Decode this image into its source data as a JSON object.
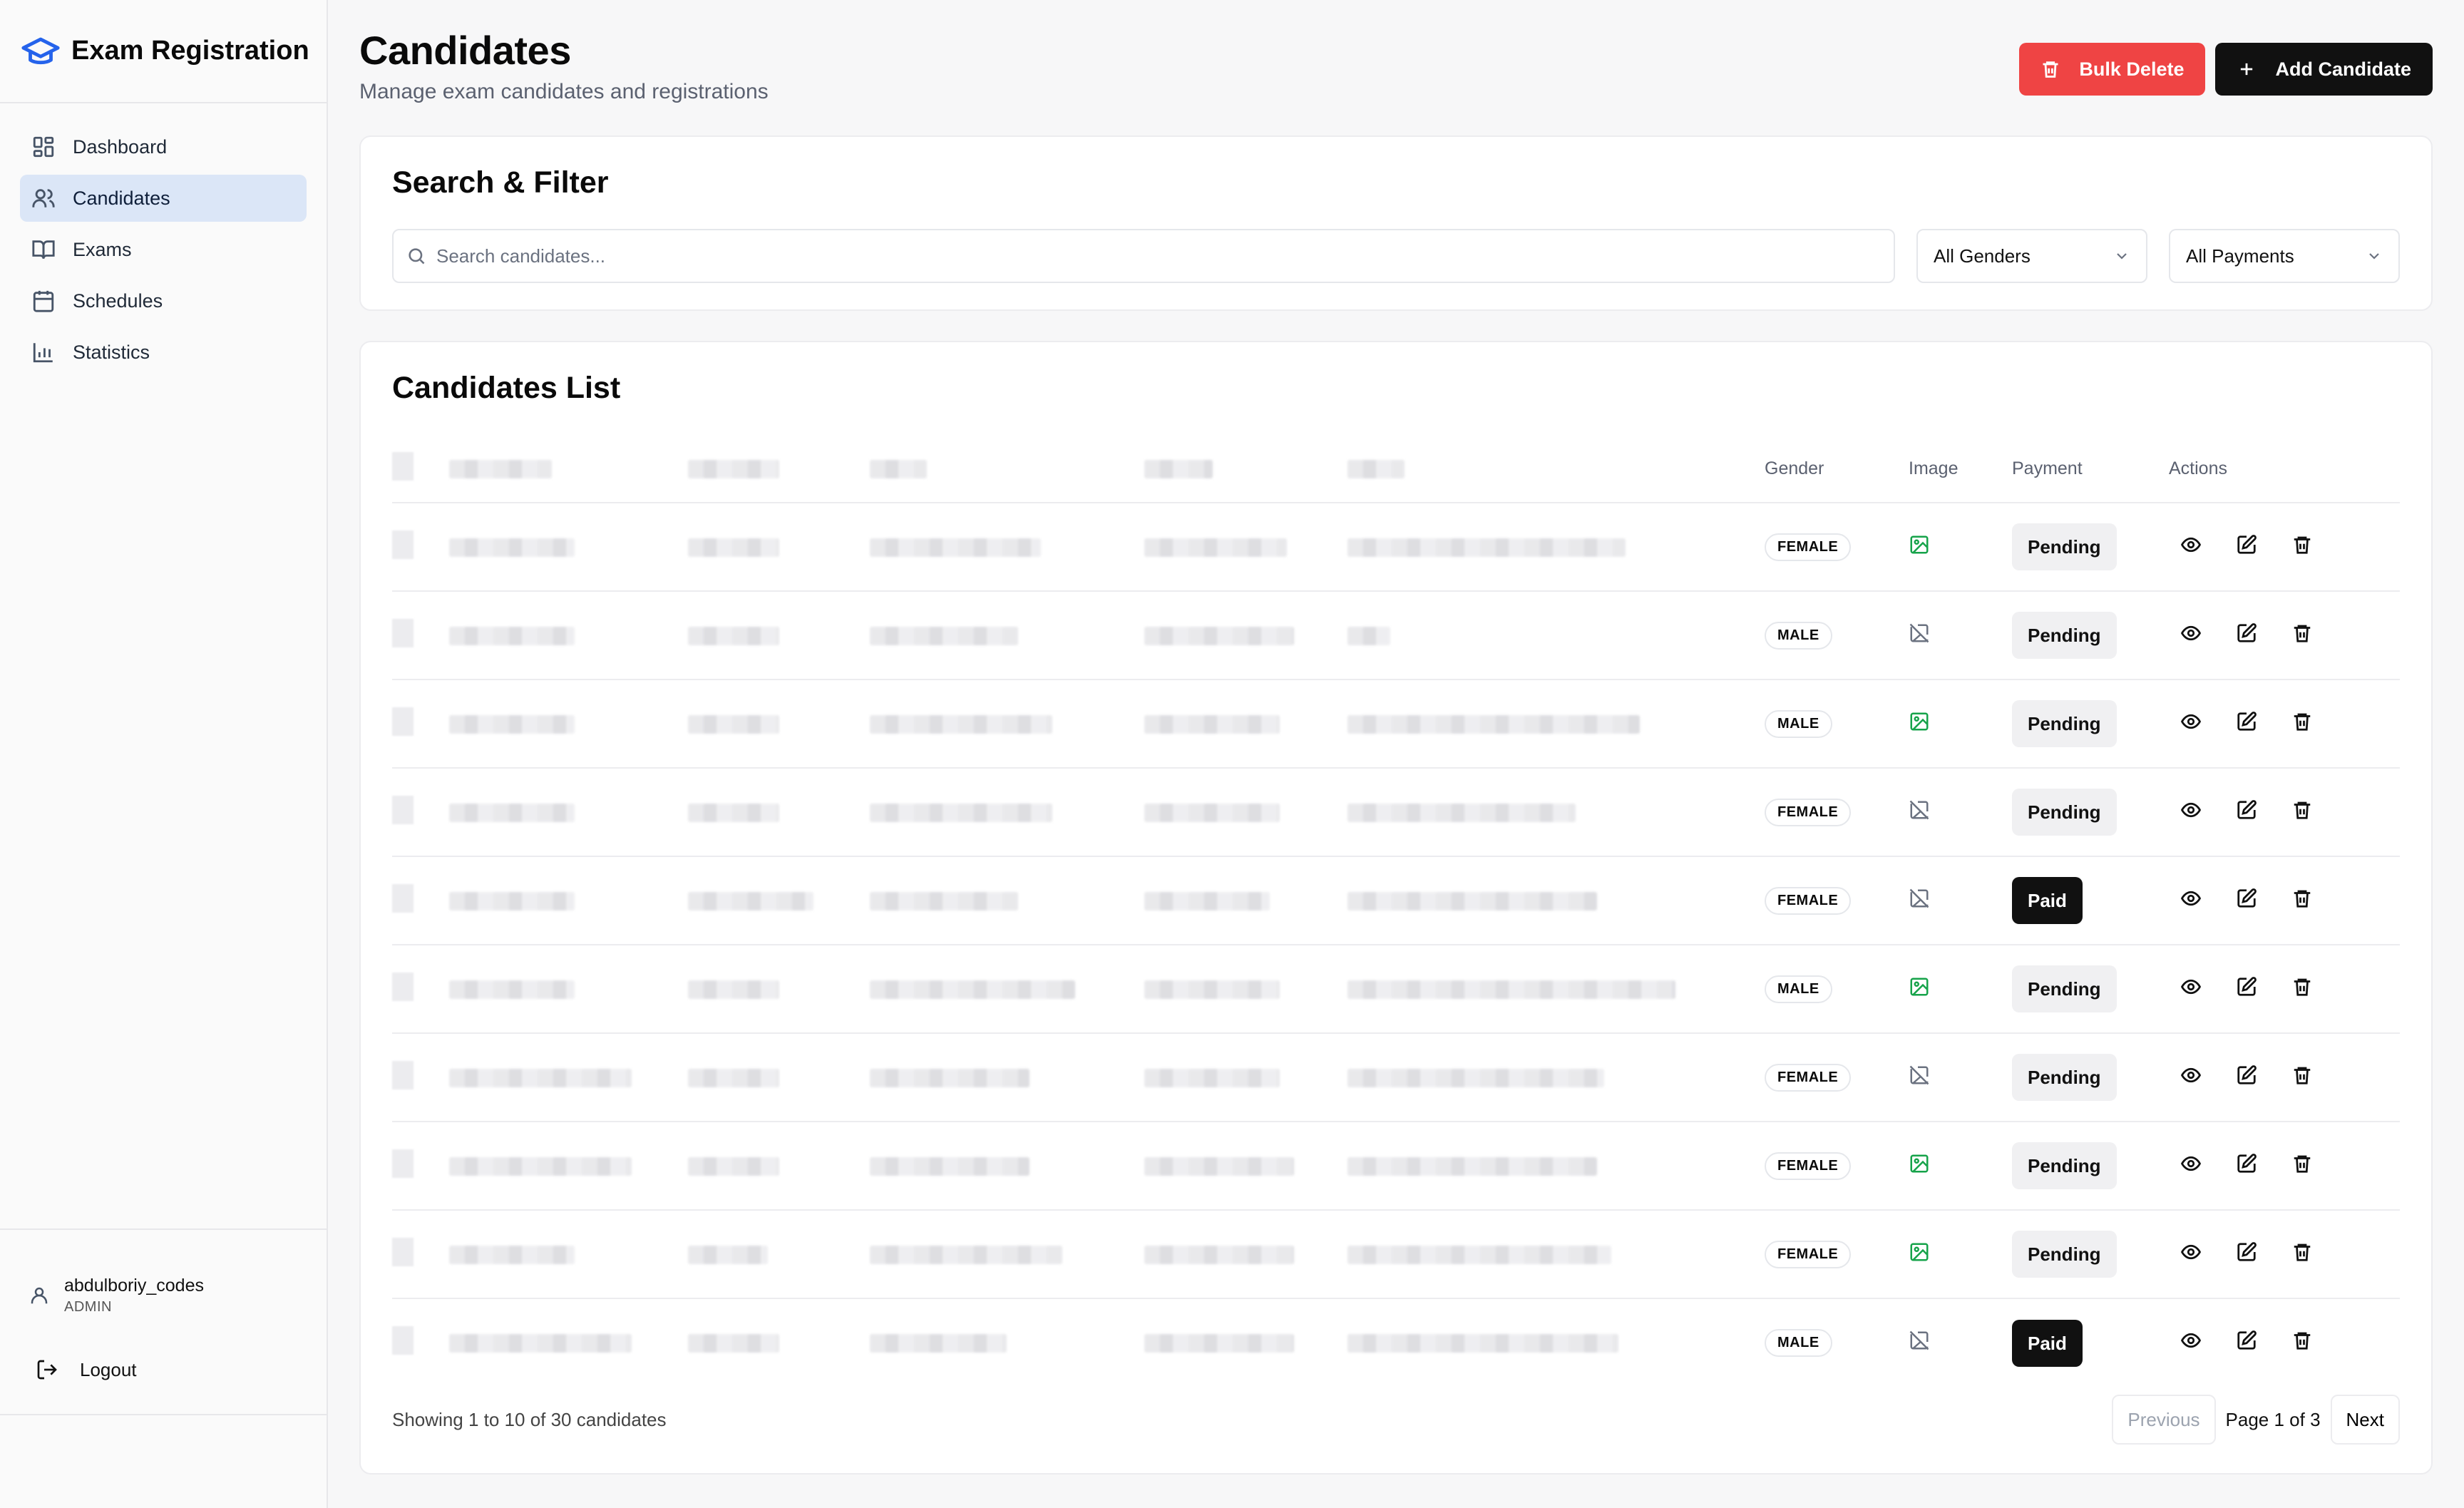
{
  "brand": {
    "name": "Exam Registration",
    "logo_icon": "graduation-cap-icon",
    "accent": "#2563eb"
  },
  "nav": [
    {
      "label": "Dashboard",
      "icon": "dashboard-icon",
      "active": false
    },
    {
      "label": "Candidates",
      "icon": "users-icon",
      "active": true
    },
    {
      "label": "Exams",
      "icon": "book-icon",
      "active": false
    },
    {
      "label": "Schedules",
      "icon": "calendar-icon",
      "active": false
    },
    {
      "label": "Statistics",
      "icon": "bar-chart-icon",
      "active": false
    }
  ],
  "user": {
    "name": "abdulboriy_codes",
    "role": "ADMIN"
  },
  "logout_label": "Logout",
  "header": {
    "title": "Candidates",
    "subtitle": "Manage exam candidates and registrations",
    "bulk_delete_label": "Bulk Delete",
    "add_label": "Add Candidate"
  },
  "filter": {
    "title": "Search & Filter",
    "search_placeholder": "Search candidates...",
    "gender_select": "All Genders",
    "payment_select": "All Payments"
  },
  "list": {
    "title": "Candidates List",
    "columns": {
      "gender": "Gender",
      "image": "Image",
      "payment": "Payment",
      "actions": "Actions"
    },
    "rows": [
      {
        "gender": "FEMALE",
        "has_image": true,
        "payment": "Pending"
      },
      {
        "gender": "MALE",
        "has_image": false,
        "payment": "Pending"
      },
      {
        "gender": "MALE",
        "has_image": true,
        "payment": "Pending"
      },
      {
        "gender": "FEMALE",
        "has_image": false,
        "payment": "Pending"
      },
      {
        "gender": "FEMALE",
        "has_image": false,
        "payment": "Paid"
      },
      {
        "gender": "MALE",
        "has_image": true,
        "payment": "Pending"
      },
      {
        "gender": "FEMALE",
        "has_image": false,
        "payment": "Pending"
      },
      {
        "gender": "FEMALE",
        "has_image": true,
        "payment": "Pending"
      },
      {
        "gender": "FEMALE",
        "has_image": true,
        "payment": "Pending"
      },
      {
        "gender": "MALE",
        "has_image": false,
        "payment": "Paid"
      }
    ],
    "showing": "Showing 1 to 10 of 30 candidates",
    "prev_label": "Previous",
    "page_info": "Page 1 of 3",
    "next_label": "Next"
  },
  "colors": {
    "danger": "#ef4444",
    "dark": "#111111",
    "active_nav_bg": "#dbe6f7",
    "image_present": "#16a34a",
    "image_missing": "#6b7280"
  }
}
